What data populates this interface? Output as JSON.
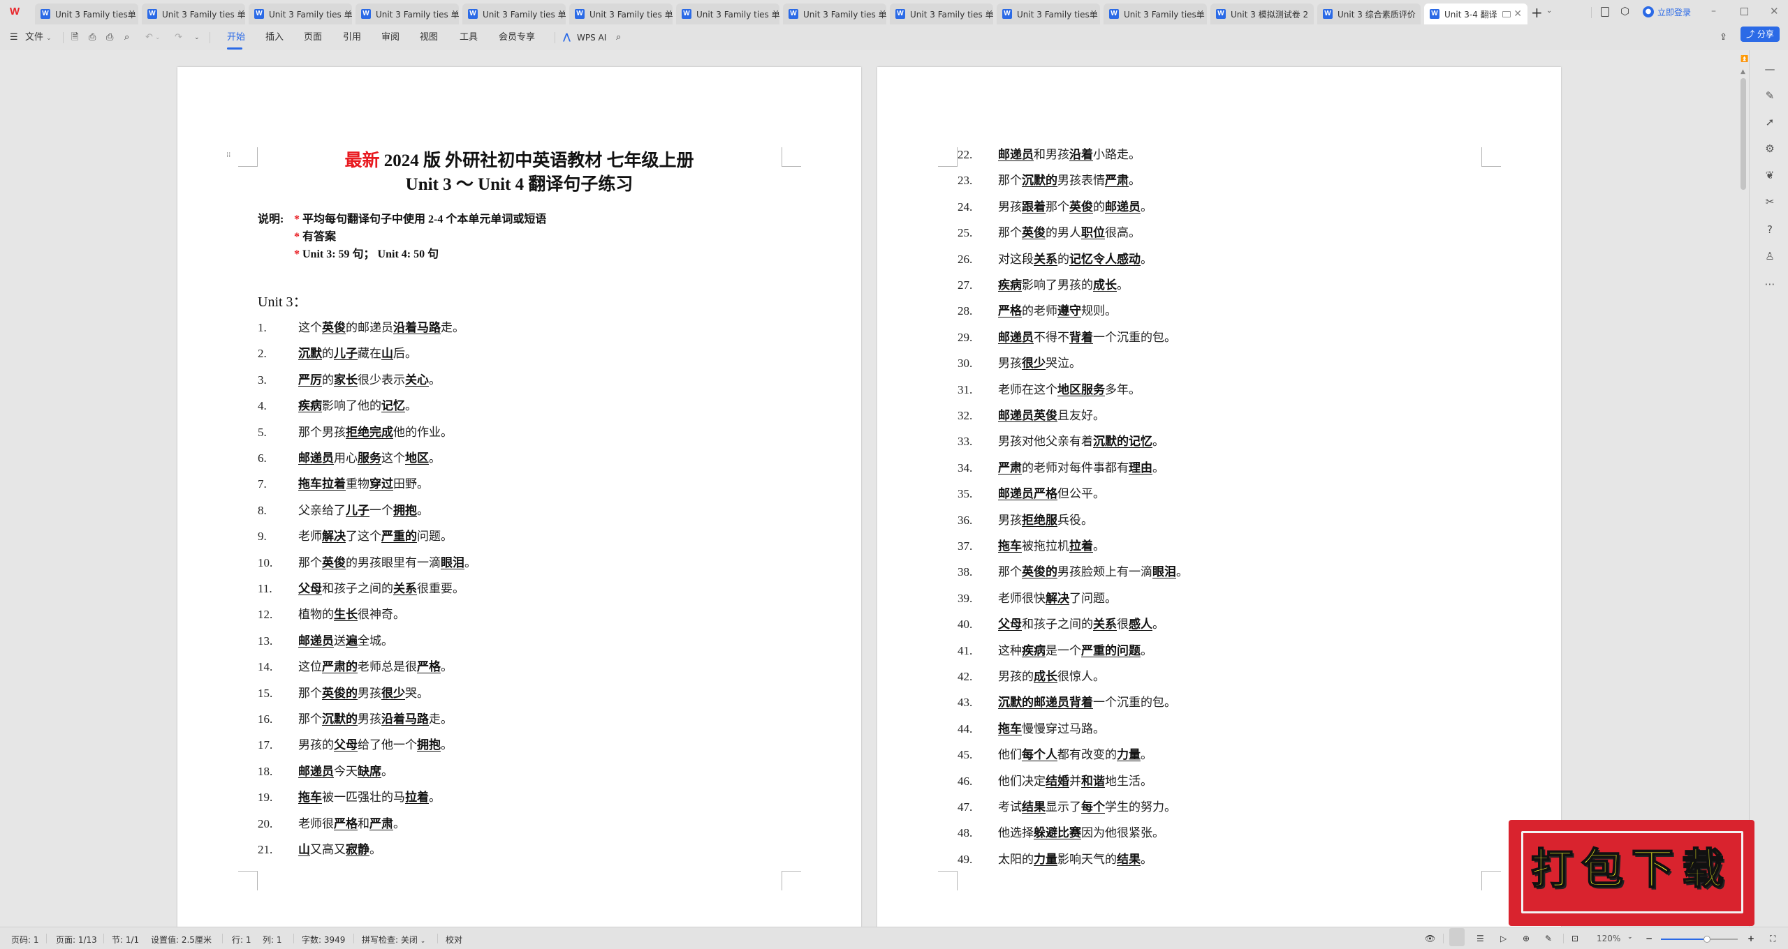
{
  "app": {
    "logo": "W",
    "tabs": [
      {
        "label": "Unit 3  Family ties单"
      },
      {
        "label": "Unit 3 Family ties 单"
      },
      {
        "label": "Unit 3 Family ties 单"
      },
      {
        "label": "Unit 3 Family ties 单"
      },
      {
        "label": "Unit 3 Family ties 单"
      },
      {
        "label": "Unit 3 Family ties 单"
      },
      {
        "label": "Unit 3 Family ties 单"
      },
      {
        "label": "Unit 3 Family ties 单"
      },
      {
        "label": "Unit 3 Family ties 单"
      },
      {
        "label": "Unit 3 Family ties单"
      },
      {
        "label": "Unit 3 Family ties单"
      },
      {
        "label": "Unit 3 模拟测试卷 2"
      },
      {
        "label": "Unit 3 综合素质评价"
      },
      {
        "label": "Unit 3-4 翻译",
        "active": true
      }
    ],
    "new_tab": "+",
    "login": "立即登录"
  },
  "toolbar": {
    "file_menu": "文件",
    "menu_tabs": [
      "开始",
      "插入",
      "页面",
      "引用",
      "审阅",
      "视图",
      "工具",
      "会员专享"
    ],
    "active_tab": "开始",
    "wps_ai": "WPS AI",
    "share": "分享"
  },
  "document": {
    "title_red": "最新",
    "title_rest": " 2024 版  外研社初中英语教材  七年级上册",
    "subtitle": "Unit 3 ～ Unit 4   翻译句子练习",
    "notes_label": "说明:",
    "notes": [
      "平均每句翻译句子中使用 2-4 个本单元单词或短语",
      "有答案",
      "Unit 3: 59 句；   Unit 4: 50 句"
    ],
    "unit_heading": "Unit 3：",
    "sentences_left": [
      {
        "num": "1.",
        "parts": [
          [
            "这个",
            0
          ],
          [
            "英俊",
            1
          ],
          [
            "的邮递员",
            0
          ],
          [
            "沿着马路",
            1
          ],
          [
            "走。",
            0
          ]
        ]
      },
      {
        "num": "2.",
        "parts": [
          [
            "沉默",
            1
          ],
          [
            "的",
            0
          ],
          [
            "儿子",
            1
          ],
          [
            "藏在",
            0
          ],
          [
            "山",
            1
          ],
          [
            "后。",
            0
          ]
        ]
      },
      {
        "num": "3.",
        "parts": [
          [
            "严厉",
            1
          ],
          [
            "的",
            0
          ],
          [
            "家长",
            1
          ],
          [
            "很少表示",
            0
          ],
          [
            "关心",
            1
          ],
          [
            "。",
            0
          ]
        ]
      },
      {
        "num": "4.",
        "parts": [
          [
            "疾病",
            1
          ],
          [
            "影响了他的",
            0
          ],
          [
            "记忆",
            1
          ],
          [
            "。",
            0
          ]
        ]
      },
      {
        "num": "5.",
        "parts": [
          [
            "那个男孩",
            0
          ],
          [
            "拒绝完成",
            1
          ],
          [
            "他的作业。",
            0
          ]
        ]
      },
      {
        "num": "6.",
        "parts": [
          [
            "邮递员",
            1
          ],
          [
            "用心",
            0
          ],
          [
            "服务",
            1
          ],
          [
            "这个",
            0
          ],
          [
            "地区",
            1
          ],
          [
            "。",
            0
          ]
        ]
      },
      {
        "num": "7.",
        "parts": [
          [
            "拖车拉着",
            1
          ],
          [
            "重物",
            0
          ],
          [
            "穿过",
            1
          ],
          [
            "田野。",
            0
          ]
        ]
      },
      {
        "num": "8.",
        "parts": [
          [
            "父亲给了",
            0
          ],
          [
            "儿子",
            1
          ],
          [
            "一个",
            0
          ],
          [
            "拥抱",
            1
          ],
          [
            "。",
            0
          ]
        ]
      },
      {
        "num": "9.",
        "parts": [
          [
            "老师",
            0
          ],
          [
            "解决",
            1
          ],
          [
            "了这个",
            0
          ],
          [
            "严重的",
            1
          ],
          [
            "问题。",
            0
          ]
        ]
      },
      {
        "num": "10.",
        "parts": [
          [
            "那个",
            0
          ],
          [
            "英俊",
            1
          ],
          [
            "的男孩眼里有一滴",
            0
          ],
          [
            "眼泪",
            1
          ],
          [
            "。",
            0
          ]
        ]
      },
      {
        "num": "11.",
        "parts": [
          [
            "父母",
            1
          ],
          [
            "和孩子之间的",
            0
          ],
          [
            "关系",
            1
          ],
          [
            "很重要。",
            0
          ]
        ]
      },
      {
        "num": "12.",
        "parts": [
          [
            "植物的",
            0
          ],
          [
            "生长",
            1
          ],
          [
            "很神奇。",
            0
          ]
        ]
      },
      {
        "num": "13.",
        "parts": [
          [
            "邮递员",
            1
          ],
          [
            "送",
            0
          ],
          [
            "遍",
            1
          ],
          [
            "全城。",
            0
          ]
        ]
      },
      {
        "num": "14.",
        "parts": [
          [
            "这位",
            0
          ],
          [
            "严肃的",
            1
          ],
          [
            "老师总是很",
            0
          ],
          [
            "严格",
            1
          ],
          [
            "。",
            0
          ]
        ]
      },
      {
        "num": "15.",
        "parts": [
          [
            "那个",
            0
          ],
          [
            "英俊的",
            1
          ],
          [
            "男孩",
            0
          ],
          [
            "很少",
            1
          ],
          [
            "哭。",
            0
          ]
        ]
      },
      {
        "num": "16.",
        "parts": [
          [
            "那个",
            0
          ],
          [
            "沉默的",
            1
          ],
          [
            "男孩",
            0
          ],
          [
            "沿着马路",
            1
          ],
          [
            "走。",
            0
          ]
        ]
      },
      {
        "num": "17.",
        "parts": [
          [
            "男孩的",
            0
          ],
          [
            "父母",
            1
          ],
          [
            "给了他一个",
            0
          ],
          [
            "拥抱",
            1
          ],
          [
            "。",
            0
          ]
        ]
      },
      {
        "num": "18.",
        "parts": [
          [
            "邮递员",
            1
          ],
          [
            "今天",
            0
          ],
          [
            "缺席",
            1
          ],
          [
            "。",
            0
          ]
        ]
      },
      {
        "num": "19.",
        "parts": [
          [
            "拖车",
            1
          ],
          [
            "被一匹强壮的马",
            0
          ],
          [
            "拉着",
            1
          ],
          [
            "。",
            0
          ]
        ]
      },
      {
        "num": "20.",
        "parts": [
          [
            "老师很",
            0
          ],
          [
            "严格",
            1
          ],
          [
            "和",
            0
          ],
          [
            "严肃",
            1
          ],
          [
            "。",
            0
          ]
        ]
      },
      {
        "num": "21.",
        "parts": [
          [
            "山",
            1
          ],
          [
            "又高又",
            0
          ],
          [
            "寂静",
            1
          ],
          [
            "。",
            0
          ]
        ]
      }
    ],
    "sentences_right": [
      {
        "num": "22.",
        "parts": [
          [
            "邮递员",
            1
          ],
          [
            "和男孩",
            0
          ],
          [
            "沿着",
            1
          ],
          [
            "小路走。",
            0
          ]
        ]
      },
      {
        "num": "23.",
        "parts": [
          [
            "那个",
            0
          ],
          [
            "沉默的",
            1
          ],
          [
            "男孩表情",
            0
          ],
          [
            "严肃",
            1
          ],
          [
            "。",
            0
          ]
        ]
      },
      {
        "num": "24.",
        "parts": [
          [
            "男孩",
            0
          ],
          [
            "跟着",
            1
          ],
          [
            "那个",
            0
          ],
          [
            "英俊",
            1
          ],
          [
            "的",
            0
          ],
          [
            "邮递员",
            1
          ],
          [
            "。",
            0
          ]
        ]
      },
      {
        "num": "25.",
        "parts": [
          [
            "那个",
            0
          ],
          [
            "英俊",
            1
          ],
          [
            "的男人",
            0
          ],
          [
            "职位",
            1
          ],
          [
            "很高。",
            0
          ]
        ]
      },
      {
        "num": "26.",
        "parts": [
          [
            "对这段",
            0
          ],
          [
            "关系",
            1
          ],
          [
            "的",
            0
          ],
          [
            "记忆令人感动",
            1
          ],
          [
            "。",
            0
          ]
        ]
      },
      {
        "num": "27.",
        "parts": [
          [
            "疾病",
            1
          ],
          [
            "影响了男孩的",
            0
          ],
          [
            "成长",
            1
          ],
          [
            "。",
            0
          ]
        ]
      },
      {
        "num": "28.",
        "parts": [
          [
            "严格",
            1
          ],
          [
            "的老师",
            0
          ],
          [
            "遵守",
            1
          ],
          [
            "规则。",
            0
          ]
        ]
      },
      {
        "num": "29.",
        "parts": [
          [
            "邮递员",
            1
          ],
          [
            "不得不",
            0
          ],
          [
            "背着",
            1
          ],
          [
            "一个沉重的包。",
            0
          ]
        ]
      },
      {
        "num": "30.",
        "parts": [
          [
            "男孩",
            0
          ],
          [
            "很少",
            1
          ],
          [
            "哭泣。",
            0
          ]
        ]
      },
      {
        "num": "31.",
        "parts": [
          [
            "老师在这个",
            0
          ],
          [
            "地区服务",
            1
          ],
          [
            "多年。",
            0
          ]
        ]
      },
      {
        "num": "32.",
        "parts": [
          [
            "邮递员英俊",
            1
          ],
          [
            "且友好。",
            0
          ]
        ]
      },
      {
        "num": "33.",
        "parts": [
          [
            "男孩对他父亲有着",
            0
          ],
          [
            "沉默的记忆",
            1
          ],
          [
            "。",
            0
          ]
        ]
      },
      {
        "num": "34.",
        "parts": [
          [
            "严肃",
            1
          ],
          [
            "的老师对每件事都有",
            0
          ],
          [
            "理由",
            1
          ],
          [
            "。",
            0
          ]
        ]
      },
      {
        "num": "35.",
        "parts": [
          [
            "邮递员严格",
            1
          ],
          [
            "但公平。",
            0
          ]
        ]
      },
      {
        "num": "36.",
        "parts": [
          [
            "男孩",
            0
          ],
          [
            "拒绝服",
            1
          ],
          [
            "兵役。",
            0
          ]
        ]
      },
      {
        "num": "37.",
        "parts": [
          [
            "拖车",
            1
          ],
          [
            "被拖拉机",
            0
          ],
          [
            "拉着",
            1
          ],
          [
            "。",
            0
          ]
        ]
      },
      {
        "num": "38.",
        "parts": [
          [
            "那个",
            0
          ],
          [
            "英俊的",
            1
          ],
          [
            "男孩脸颊上有一滴",
            0
          ],
          [
            "眼泪",
            1
          ],
          [
            "。",
            0
          ]
        ]
      },
      {
        "num": "39.",
        "parts": [
          [
            "老师很快",
            0
          ],
          [
            "解决",
            1
          ],
          [
            "了问题。",
            0
          ]
        ]
      },
      {
        "num": "40.",
        "parts": [
          [
            "父母",
            1
          ],
          [
            "和孩子之间的",
            0
          ],
          [
            "关系",
            1
          ],
          [
            "很",
            0
          ],
          [
            "感人",
            1
          ],
          [
            "。",
            0
          ]
        ]
      },
      {
        "num": "41.",
        "parts": [
          [
            "这种",
            0
          ],
          [
            "疾病",
            1
          ],
          [
            "是一个",
            0
          ],
          [
            "严重的问题",
            1
          ],
          [
            "。",
            0
          ]
        ]
      },
      {
        "num": "42.",
        "parts": [
          [
            "男孩的",
            0
          ],
          [
            "成长",
            1
          ],
          [
            "很惊人。",
            0
          ]
        ]
      },
      {
        "num": "43.",
        "parts": [
          [
            "沉默的邮递员背着",
            1
          ],
          [
            "一个沉重的包。",
            0
          ]
        ]
      },
      {
        "num": "44.",
        "parts": [
          [
            "拖车",
            1
          ],
          [
            "慢慢穿过马路。",
            0
          ]
        ]
      },
      {
        "num": "45.",
        "parts": [
          [
            "他们",
            0
          ],
          [
            "每个人",
            1
          ],
          [
            "都有改变的",
            0
          ],
          [
            "力量",
            1
          ],
          [
            "。",
            0
          ]
        ]
      },
      {
        "num": "46.",
        "parts": [
          [
            "他们决定",
            0
          ],
          [
            "结婚",
            1
          ],
          [
            "并",
            0
          ],
          [
            "和谐",
            1
          ],
          [
            "地生活。",
            0
          ]
        ]
      },
      {
        "num": "47.",
        "parts": [
          [
            "考试",
            0
          ],
          [
            "结果",
            1
          ],
          [
            "显示了",
            0
          ],
          [
            "每个",
            1
          ],
          [
            "学生的努力。",
            0
          ]
        ]
      },
      {
        "num": "48.",
        "parts": [
          [
            "他选择",
            0
          ],
          [
            "躲避比赛",
            1
          ],
          [
            "因为他很紧张。",
            0
          ]
        ]
      },
      {
        "num": "49.",
        "parts": [
          [
            "太阳的",
            0
          ],
          [
            "力量",
            1
          ],
          [
            "影响天气的",
            0
          ],
          [
            "结果",
            1
          ],
          [
            "。",
            0
          ]
        ]
      }
    ]
  },
  "statusbar": {
    "page_num": "页码: 1",
    "pages": "页面: 1/13",
    "section": "节: 1/1",
    "setting": "设置值: 2.5厘米",
    "row": "行: 1",
    "col": "列: 1",
    "word_count": "字数: 3949",
    "spell_check": "拼写检查: 关闭",
    "proofread": "校对",
    "zoom": "120%",
    "zoom_fraction": 0.6
  },
  "promo": {
    "text": "打包下载"
  },
  "colors": {
    "accent": "#2b6ae6",
    "title_red": "#e8191f",
    "promo_red": "#d9232e",
    "promo_text": "#ffff22"
  }
}
